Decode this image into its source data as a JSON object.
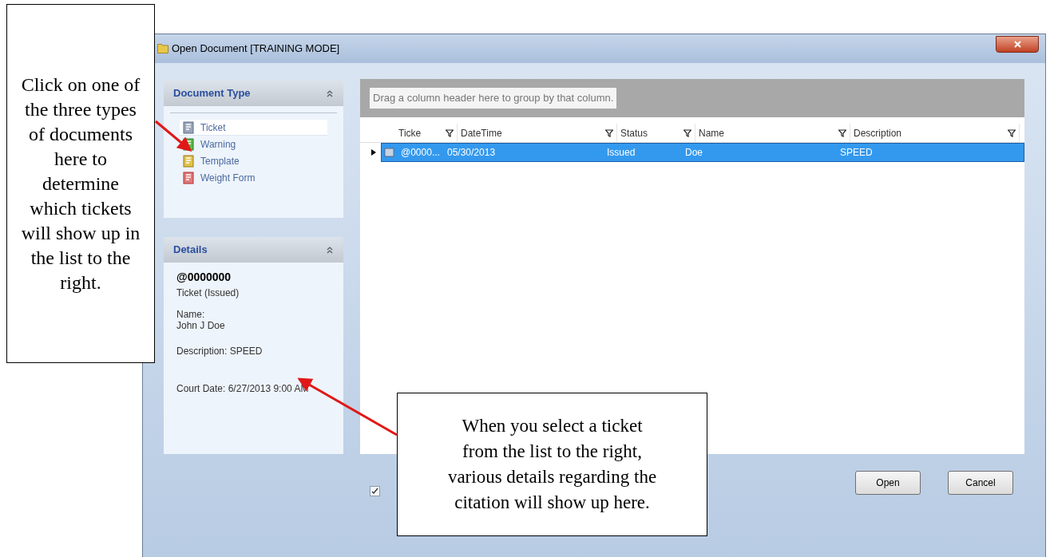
{
  "window": {
    "title": "Open Document [TRAINING MODE]"
  },
  "document_type": {
    "title": "Document Type",
    "expanded": true,
    "items": [
      {
        "label": "Ticket",
        "kind": "ticket",
        "selected": true
      },
      {
        "label": "Warning",
        "kind": "warning",
        "selected": false
      },
      {
        "label": "Template",
        "kind": "template",
        "selected": false
      },
      {
        "label": "Weight Form",
        "kind": "weight",
        "selected": false
      }
    ]
  },
  "details": {
    "title": "Details",
    "expanded": true,
    "number": "@0000000",
    "type": "Ticket (Issued)",
    "name_label": "Name:",
    "name": "John J Doe",
    "description": "Description: SPEED",
    "court_date": "Court Date: 6/27/2013 9:00 AM"
  },
  "grid": {
    "group_hint": "Drag a column header here to group by that column.",
    "columns": [
      "Ticke",
      "DateTime",
      "Status",
      "Name",
      "Description"
    ],
    "rows": [
      {
        "cells": [
          "@0000...",
          "05/30/2013",
          "Issued",
          "Doe",
          "SPEED"
        ],
        "selected": true
      }
    ]
  },
  "checkbox": {
    "checked": true
  },
  "buttons": [
    "Open",
    "Cancel"
  ],
  "callouts": [
    "Click on one of the three types of documents here to determine which tickets will show up in the list to the right.",
    "When you select a ticket from the list to the right, various details regarding the citation will show up here."
  ]
}
